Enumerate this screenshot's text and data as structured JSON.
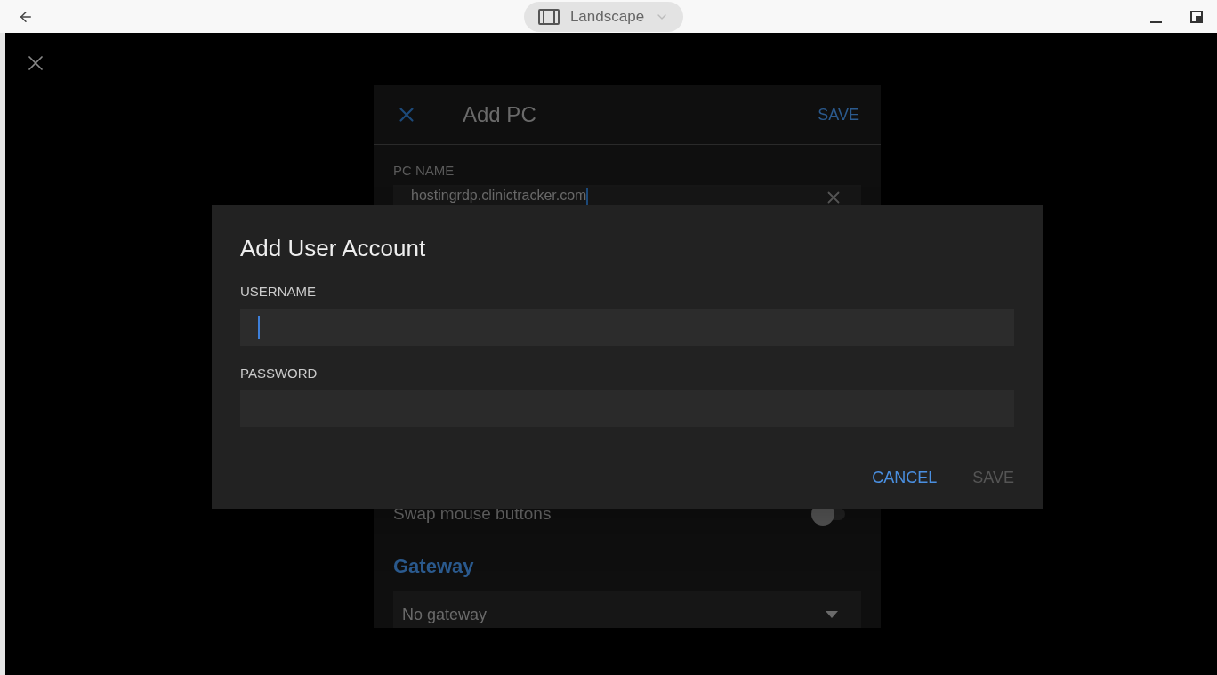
{
  "title_bar": {
    "orientation_label": "Landscape"
  },
  "add_pc": {
    "title": "Add PC",
    "save": "SAVE",
    "pc_name_label": "PC NAME",
    "pc_name_value": "hostingrdp.clinictracker.com",
    "swap_mouse": {
      "label": "Swap mouse buttons",
      "on": false
    },
    "gateway_heading": "Gateway",
    "gateway_value": "No gateway"
  },
  "dialog": {
    "title": "Add User Account",
    "fields": [
      {
        "label": "USERNAME",
        "focused": true
      },
      {
        "label": "PASSWORD",
        "focused": false
      }
    ],
    "buttons": [
      {
        "label": "CANCEL",
        "disabled": false
      },
      {
        "label": "SAVE",
        "disabled": true
      }
    ]
  }
}
